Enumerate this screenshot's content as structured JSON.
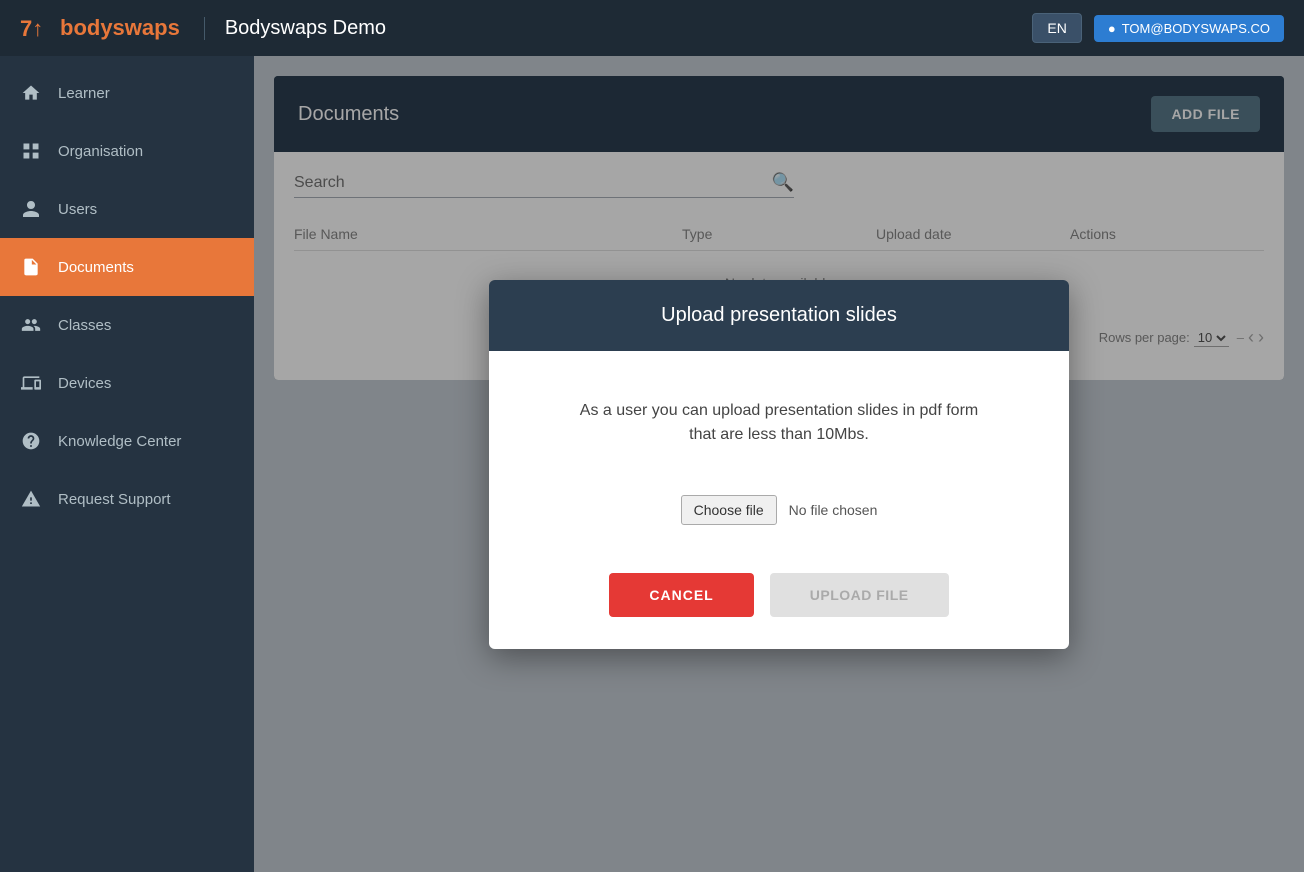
{
  "header": {
    "logo_text": "bodyswaps",
    "app_title": "Bodyswaps Demo",
    "lang_label": "EN",
    "user_icon": "account-circle",
    "user_email": "TOM@BODYSWAPS.CO"
  },
  "sidebar": {
    "items": [
      {
        "id": "learner",
        "label": "Learner",
        "icon": "home"
      },
      {
        "id": "organisation",
        "label": "Organisation",
        "icon": "grid"
      },
      {
        "id": "users",
        "label": "Users",
        "icon": "person"
      },
      {
        "id": "documents",
        "label": "Documents",
        "icon": "document",
        "active": true
      },
      {
        "id": "classes",
        "label": "Classes",
        "icon": "group"
      },
      {
        "id": "devices",
        "label": "Devices",
        "icon": "devices"
      },
      {
        "id": "knowledge-center",
        "label": "Knowledge Center",
        "icon": "question"
      },
      {
        "id": "request-support",
        "label": "Request Support",
        "icon": "warning"
      }
    ]
  },
  "documents": {
    "title": "Documents",
    "add_file_label": "ADD FILE",
    "search_placeholder": "Search",
    "table_headers": [
      "File Name",
      "Type",
      "Upload date",
      "Actions"
    ],
    "no_data_text": "No data available",
    "rows_per_page_label": "Rows per page:",
    "rows_per_page_value": "10",
    "page_range": "–"
  },
  "modal": {
    "title": "Upload presentation slides",
    "description": "As a user you can upload presentation slides in pdf form that are less than 10Mbs.",
    "choose_file_label": "Choose file",
    "no_file_text": "No file chosen",
    "cancel_label": "CANCEL",
    "upload_label": "UPLOAD FILE"
  }
}
